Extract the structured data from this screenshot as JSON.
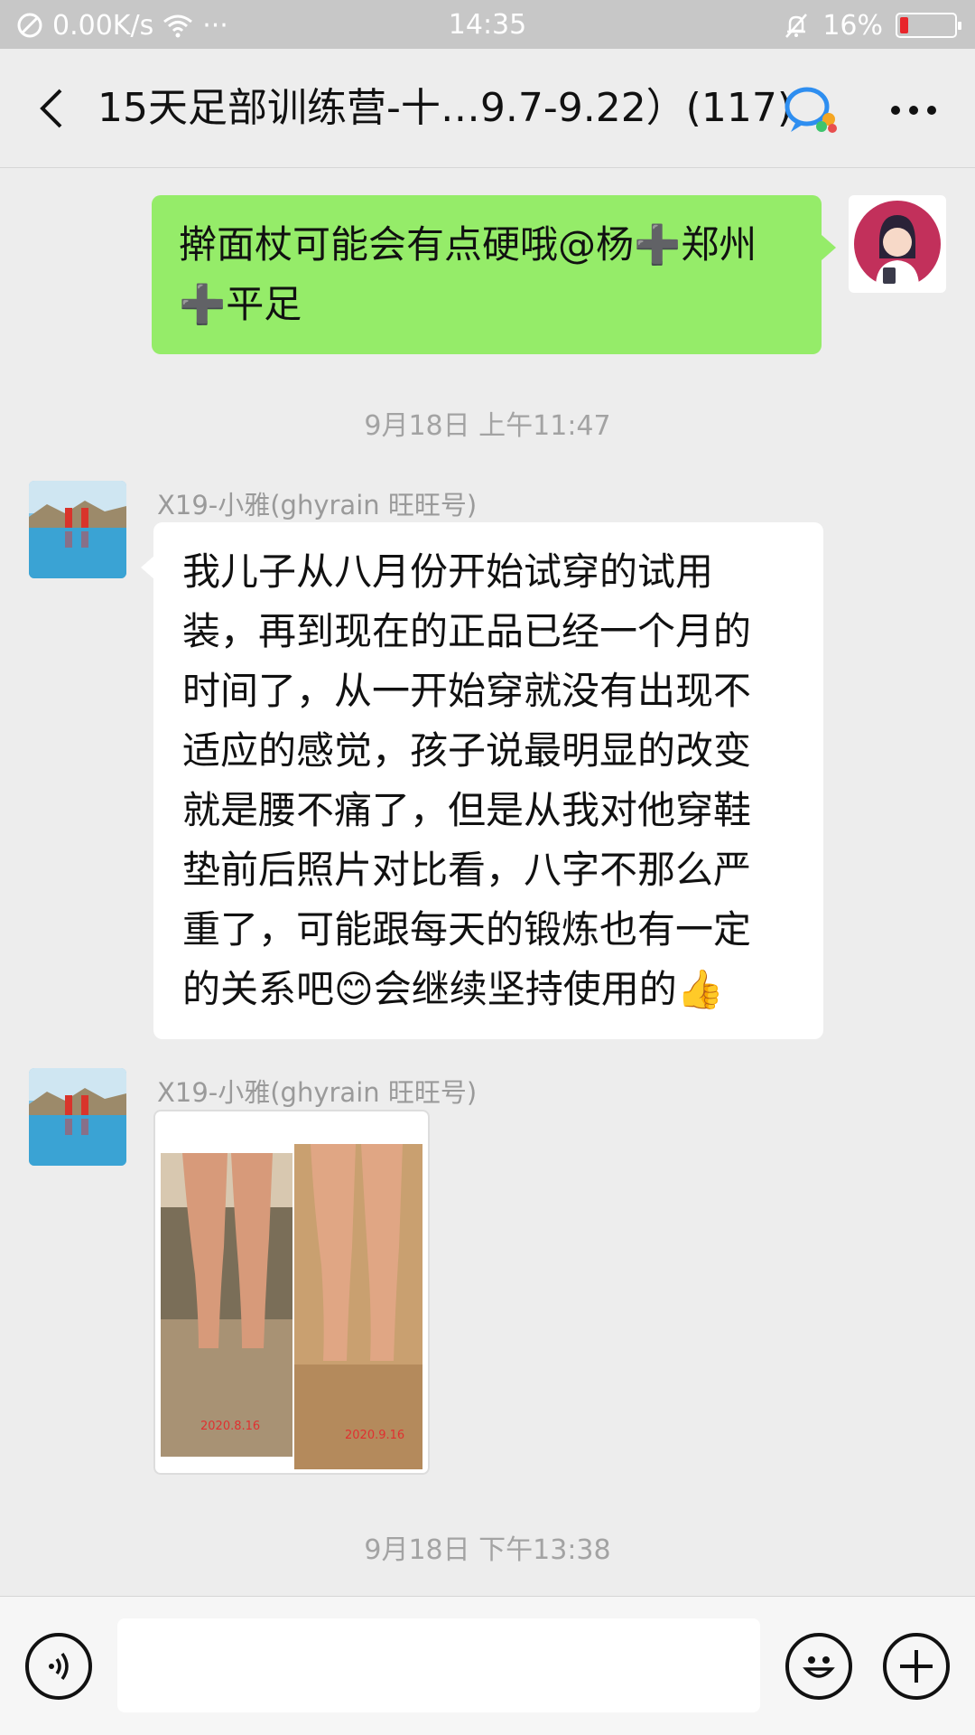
{
  "status_bar": {
    "net_speed": "0.00K/s",
    "dots": "···",
    "time": "14:35",
    "battery": "16%",
    "battery_level": 0.16
  },
  "nav": {
    "title": "15天足部训练营-十…9.7-9.22）(117)"
  },
  "messages": [
    {
      "side": "right",
      "text_line1": "擀面杖可能会有点硬哦@杨➕郑州",
      "text_line2": "➕平足"
    }
  ],
  "timestamps": [
    "9月18日 上午11:47",
    "9月18日 下午13:38"
  ],
  "incoming": [
    {
      "sender": "X19-小雅(ghyrain 旺旺号)",
      "lines": [
        "我儿子从八月份开始试穿的试用",
        "装，再到现在的正品已经一个月的",
        "时间了，从一开始穿就没有出现不",
        "适应的感觉，孩子说最明显的改变",
        "就是腰不痛了，但是从我对他穿鞋",
        "垫前后照片对比看，八字不那么严",
        "重了，可能跟每天的锻炼也有一定",
        "的关系吧😊会继续坚持使用的👍"
      ]
    },
    {
      "sender": "X19-小雅(ghyrain 旺旺号)",
      "photo_dates": [
        "2020.8.16",
        "2020.9.16"
      ]
    }
  ],
  "colors": {
    "my_bubble": "#95ec69",
    "status_bar_bg": "#c7c7c7",
    "chat_bg": "#ededed"
  },
  "icons": [
    "no-sim-icon",
    "wifi-icon",
    "mute-icon",
    "battery-icon",
    "back-icon",
    "group-chat-icon",
    "more-icon",
    "voice-icon",
    "emoji-icon",
    "plus-icon"
  ]
}
